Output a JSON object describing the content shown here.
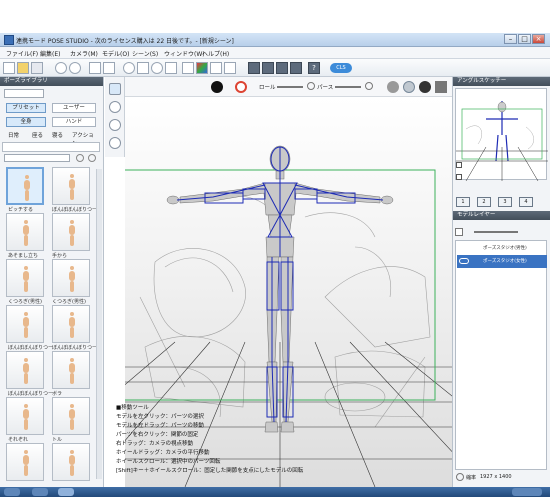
{
  "window": {
    "title": "連携モード POSE STUDIO - 次のライセンス購入は 22 日後です。- [新規シーン]"
  },
  "menu": [
    "ファイル(F)",
    "編集(E)",
    "カメラ(M)",
    "モデル(O)",
    "シーン(S)",
    "ウィンドウ(W)",
    "ヘルプ(H)"
  ],
  "toolbar": {
    "cls_badge": "CLS",
    "roll_label": "ロール",
    "perse_label": "パース"
  },
  "pose_library": {
    "title": "ポーズライブラリ",
    "tabs": [
      "プリセット",
      "ユーザー"
    ],
    "subtabs": [
      "全身",
      "ハンド"
    ],
    "categories": [
      "日常",
      "座る",
      "寝る",
      "アクション"
    ],
    "thumbs": [
      "ピッチする",
      "ぼんぼぼんぼりつー",
      "あそまし立ち",
      "手から",
      "くつろぎ(男性)",
      "くつろぎ(男性)",
      "ぼんぼぼんぼりつー",
      "ぼんぼぼんぼりつー",
      "ぼんぼぼんぼりつー",
      "ボラ",
      "それぞれ",
      "トル"
    ]
  },
  "help": {
    "lines": [
      "■移動ツール",
      "モデルを左クリック：パーツの選択",
      "モデルを左ドラッグ：パーツの移動",
      "パーツを右クリック：関節の固定",
      "右ドラッグ：カメラの視点移動",
      "ホイールドラッグ：カメラの平行移動",
      "ホイールスクロール：選択中のパーツ回転",
      "[Shift]キー＋ホイールスクロール：固定した関節を支点にしたモデルの回転"
    ]
  },
  "angle_panel": {
    "title": "アングルスケッチー",
    "buttons": [
      "1",
      "2",
      "3",
      "4"
    ]
  },
  "model_layer": {
    "title": "モデルレイヤー",
    "layers": [
      "ポーズスタジオ(男性)",
      "ポーズスタジオ(女性)"
    ]
  },
  "zoom_label": "縮率",
  "zoom_value": "1927 x 1400"
}
